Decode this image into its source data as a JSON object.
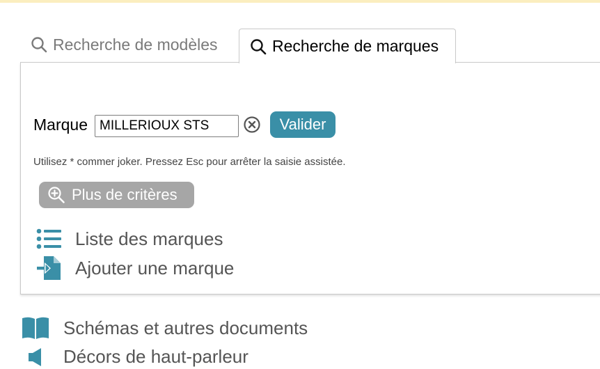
{
  "tabs": {
    "models_label": "Recherche de modèles",
    "brands_label": "Recherche de marques",
    "active": "brands"
  },
  "search": {
    "field_label": "Marque",
    "value": "MILLERIOUX STS",
    "submit_label": "Valider",
    "hint": "Utilisez * commer joker. Pressez Esc pour arrêter la saisie assistée.",
    "more_criteria_label": "Plus de critères"
  },
  "links": {
    "brand_list": "Liste des marques",
    "add_brand": "Ajouter une marque"
  },
  "extra_links": {
    "schemas": "Schémas et autres documents",
    "speaker_decors": "Décors de haut-parleur"
  },
  "icons": {
    "tab_models": "search-icon",
    "tab_brands": "search-icon",
    "clear": "clear-circle-icon",
    "more_criteria": "zoom-in-icon",
    "brand_list": "list-icon",
    "add_brand": "file-import-icon",
    "schemas": "book-open-icon",
    "speaker_decors": "speaker-icon"
  },
  "colors": {
    "accent": "#3a8fa7",
    "more_button": "#a6a6a6",
    "top_strip": "#fbeebf",
    "link_text": "#555555"
  }
}
